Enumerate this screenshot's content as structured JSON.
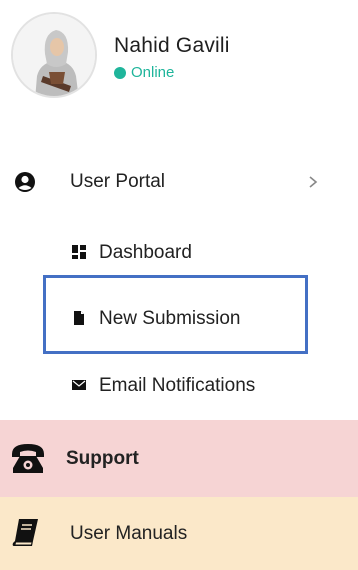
{
  "profile": {
    "name": "Nahid Gavili",
    "status": "Online",
    "status_color": "#1fb59b"
  },
  "nav": {
    "user_portal": {
      "label": "User Portal",
      "icon": "user-circle-icon"
    },
    "dashboard": {
      "label": "Dashboard",
      "icon": "dashboard-grid-icon"
    },
    "new_submission": {
      "label": "New Submission",
      "icon": "file-icon"
    },
    "email_notifications": {
      "label": "Email Notifications",
      "icon": "envelope-icon"
    },
    "support": {
      "label": "Support",
      "icon": "phone-icon"
    },
    "user_manuals": {
      "label": "User Manuals",
      "icon": "book-icon"
    }
  },
  "colors": {
    "highlight_border": "#4470c4",
    "support_bg": "#f6d4d4",
    "manuals_bg": "#fbe8c9"
  }
}
